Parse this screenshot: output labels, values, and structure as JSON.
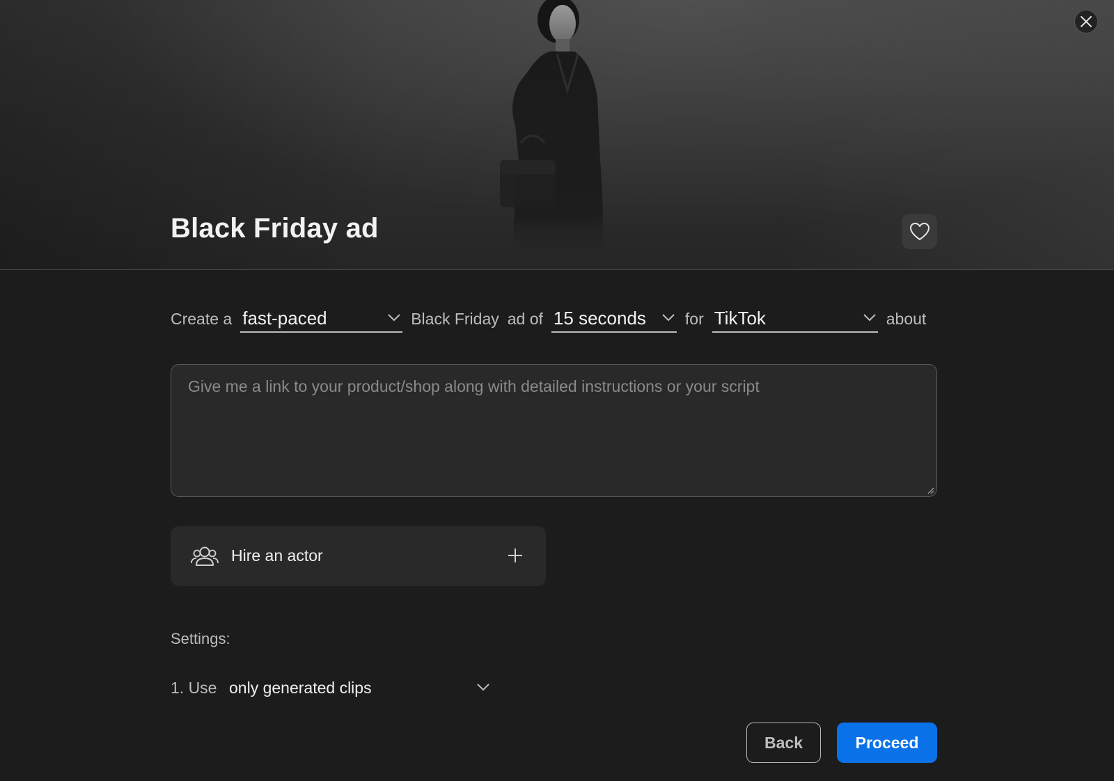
{
  "header": {
    "title": "Black Friday ad",
    "close_icon": "close-icon",
    "favorite_icon": "heart-icon"
  },
  "prompt": {
    "word_create": "Create a",
    "pace": {
      "selected": "fast-paced"
    },
    "word_topic": "Black Friday",
    "word_ad_of": "ad of",
    "duration": {
      "selected": "15 seconds"
    },
    "word_for": "for",
    "platform": {
      "selected": "TikTok"
    },
    "word_about": "about"
  },
  "description": {
    "value": "",
    "placeholder": "Give me a link to your product/shop along with detailed instructions or your script"
  },
  "actor": {
    "label": "Hire an actor",
    "icon": "people-icon",
    "add_icon": "plus-icon"
  },
  "settings": {
    "label": "Settings:",
    "items": [
      {
        "number": "1. Use",
        "selected": "only generated clips"
      }
    ]
  },
  "footer": {
    "back_label": "Back",
    "proceed_label": "Proceed"
  },
  "colors": {
    "background": "#1c1c1d",
    "accent": "#0a72e8",
    "surface": "#29292a"
  }
}
